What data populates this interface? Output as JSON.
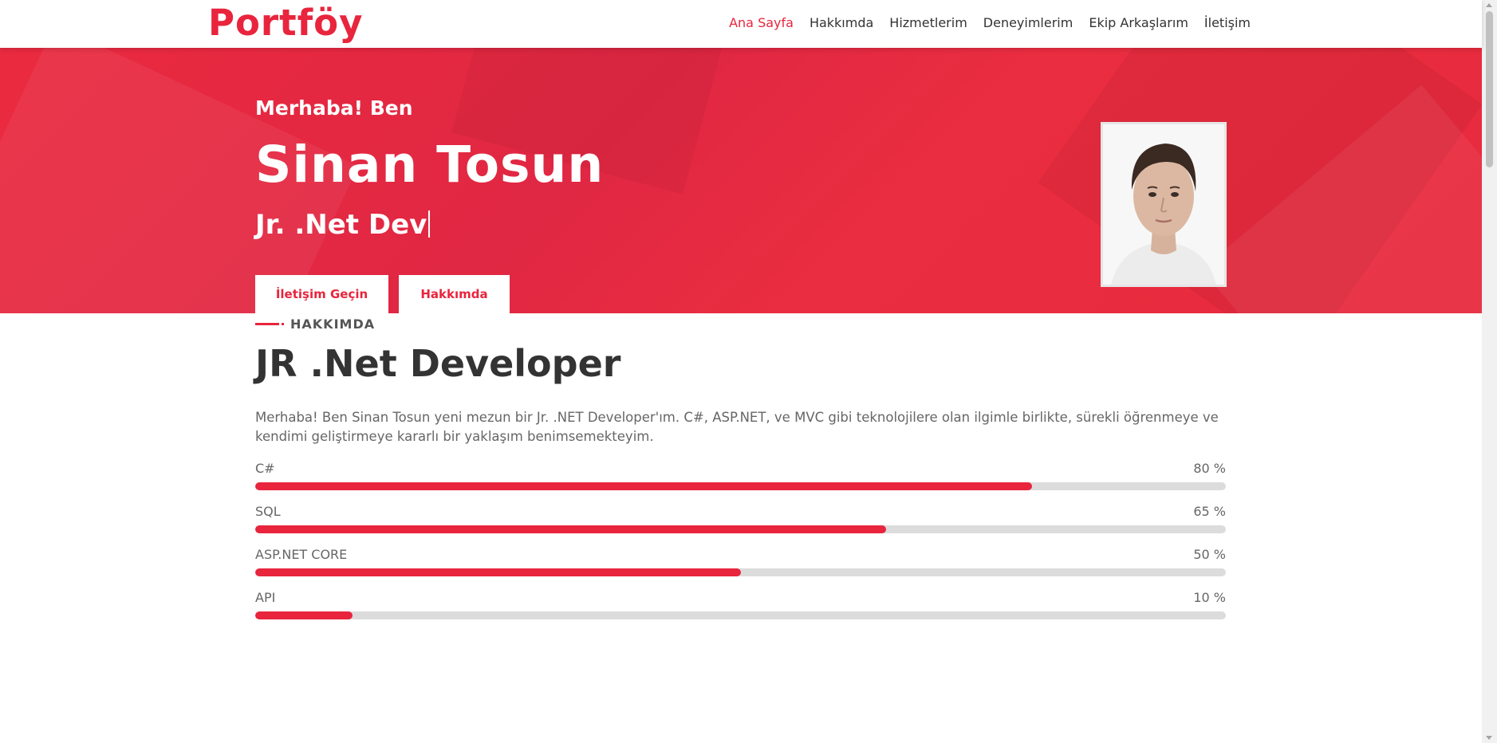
{
  "header": {
    "logo": "Portföy",
    "nav": [
      {
        "label": "Ana Sayfa",
        "active": true
      },
      {
        "label": "Hakkımda",
        "active": false
      },
      {
        "label": "Hizmetlerim",
        "active": false
      },
      {
        "label": "Deneyimlerim",
        "active": false
      },
      {
        "label": "Ekip Arkaşlarım",
        "active": false
      },
      {
        "label": "İletişim",
        "active": false
      }
    ]
  },
  "hero": {
    "greeting": "Merhaba! Ben",
    "name": "Sinan Tosun",
    "role": "Jr. .Net Dev",
    "contact_button": "İletişim Geçin",
    "about_button": "Hakkımda"
  },
  "about": {
    "tag": "HAKKIMDA",
    "heading": "JR .Net Developer",
    "paragraph": "Merhaba! Ben Sinan Tosun yeni mezun bir Jr. .NET Developer'ım. C#, ASP.NET, ve MVC gibi teknolojilere olan ilgimle birlikte, sürekli öğrenmeye ve kendimi geliştirmeye kararlı bir yaklaşım benimsemekteyim.",
    "skills": [
      {
        "name": "C#",
        "percent_label": "80 %",
        "value": 80
      },
      {
        "name": "SQL",
        "percent_label": "65 %",
        "value": 65
      },
      {
        "name": "ASP.NET CORE",
        "percent_label": "50 %",
        "value": 50
      },
      {
        "name": "API",
        "percent_label": "10 %",
        "value": 10
      }
    ]
  },
  "colors": {
    "accent": "#e8253d",
    "track": "#dcdcdc"
  }
}
